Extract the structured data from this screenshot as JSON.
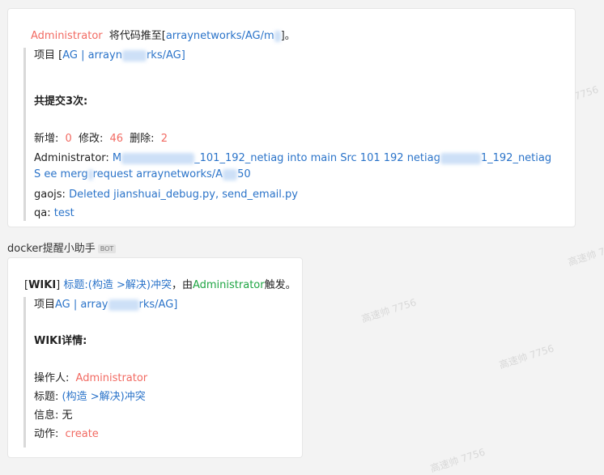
{
  "watermark_text": "高速帅 7756",
  "message1": {
    "user": "Administrator",
    "action_text": "将代码推至[",
    "target_visible": "arrayn",
    "target_tail": "etworks/AG/m",
    "close_text": "]。",
    "project_label": "项目",
    "project_link_a": "AG | arrayn",
    "project_link_b": "rks/AG]",
    "project_bracket": "[",
    "commits_title": "共提交3次:",
    "stats": {
      "added_label": "新增:",
      "added_value": "0",
      "modified_label": "修改:",
      "modified_value": "46",
      "deleted_label": "删除:",
      "deleted_value": "2"
    },
    "commits": [
      {
        "author": "Administrator:",
        "text_a": "M",
        "text_b": "_101_192_netiag into main Src 101 192 netiag",
        "text_c": "1_192_netiag S",
        "text_d": "ee merg",
        "text_e": "request arraynetworks/A",
        "text_f": "50"
      },
      {
        "author": "gaojs:",
        "text": "Deleted jianshuai_debug.py, send_email.py"
      },
      {
        "author": "qa:",
        "text": "test"
      }
    ]
  },
  "sender": {
    "name": "docker提醒小助手",
    "badge": "BOT"
  },
  "message2": {
    "tag_open": "[",
    "tag": "WIKI",
    "tag_close": "]",
    "title_link": "标题:(构造 >解决)冲突",
    "by_text": "，由",
    "user": "Administrator",
    "trigger_text": "触发。",
    "project_label": "项目",
    "project_link_a": "AG | array",
    "project_link_b": "rks/AG]",
    "details_title": "WIKI详情:",
    "operator_label": "操作人:",
    "operator_value": "Administrator",
    "title_label": "标题:",
    "title_value": "(构造 >解决)冲突",
    "info_label": "信息:",
    "info_value": "无",
    "action_label": "动作:",
    "action_value": "create"
  }
}
